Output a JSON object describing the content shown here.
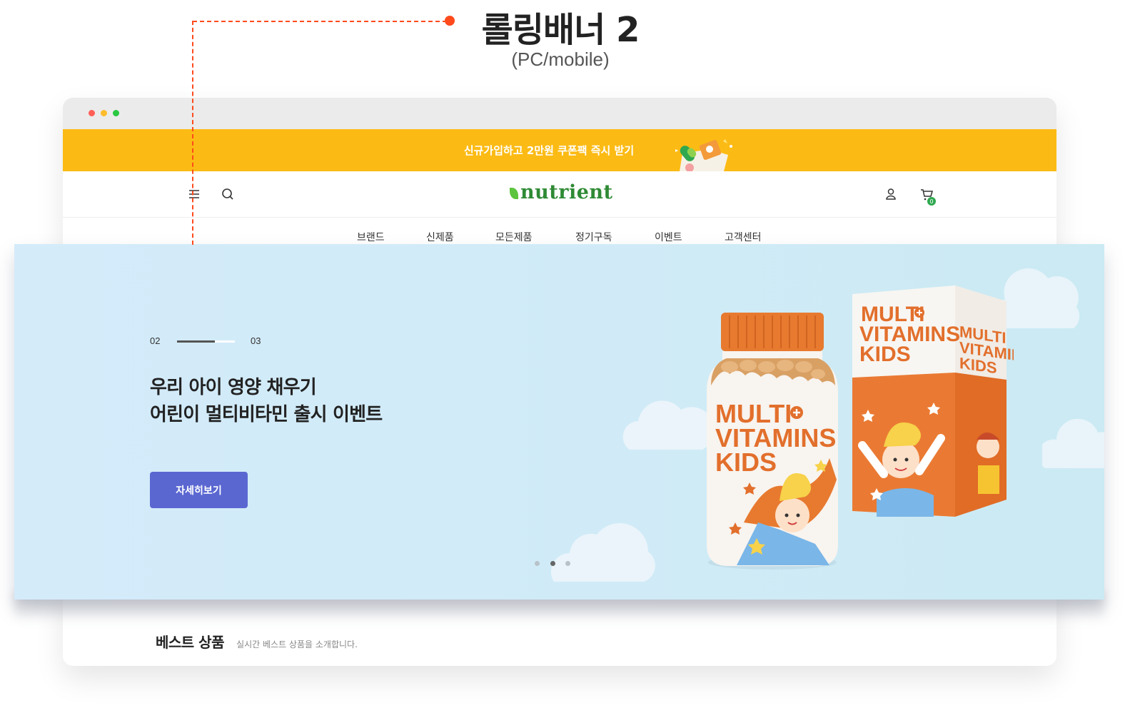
{
  "annotation": {
    "title": "롤링배너 2",
    "subtitle": "(PC/mobile)",
    "accent": "#ff4a1c"
  },
  "browser": {
    "promo_bar": {
      "text": "신규가입하고 2만원 쿠폰팩 즉시 받기",
      "color": "#fcbb14"
    },
    "header": {
      "logo": "nutrient",
      "logo_color": "#2f8a35",
      "icons": [
        "menu-icon",
        "search-icon",
        "user-icon",
        "cart-icon"
      ],
      "cart_count": "0"
    },
    "nav": [
      "브랜드",
      "신제품",
      "모든제품",
      "정기구독",
      "이벤트",
      "고객센터"
    ],
    "best_section": {
      "title": "베스트 상품",
      "subtitle": "실시간 베스트 상품을 소개합니다."
    }
  },
  "hero": {
    "pager_current": "02",
    "pager_total": "03",
    "pager_progress": 0.66,
    "headline_line1": "우리 아이 영양 채우기",
    "headline_line2": "어린이 멀티비타민 출시 이벤트",
    "button_label": "자세히보기",
    "button_color": "#5a67d1",
    "slide_dots": 3,
    "active_dot": 2,
    "product_label": [
      "MULTI",
      "VITAMINS",
      "KIDS"
    ]
  }
}
